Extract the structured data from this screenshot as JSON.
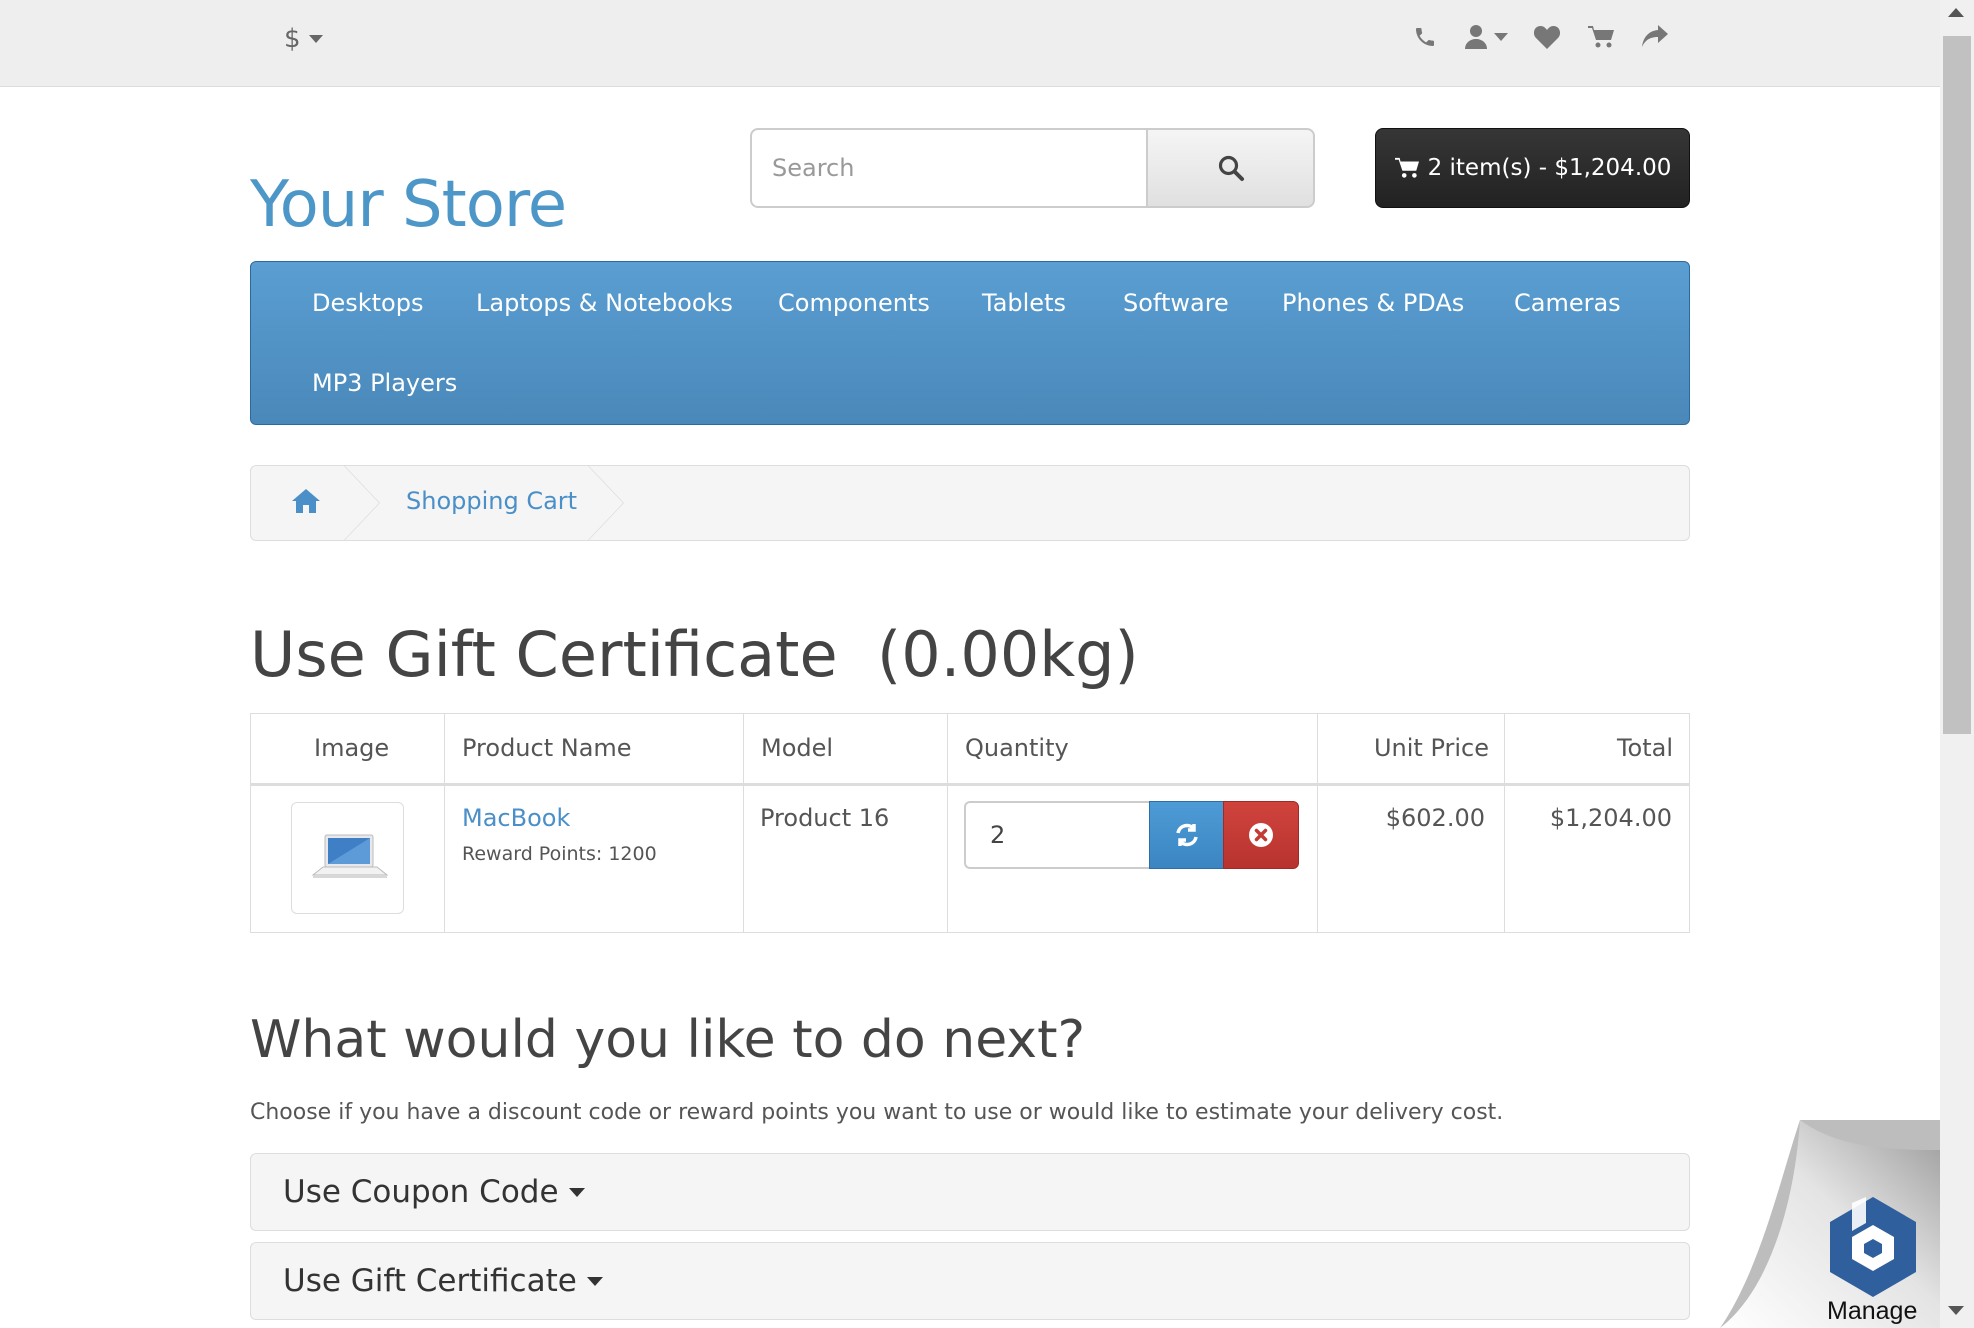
{
  "top_bar": {
    "currency_symbol": "$",
    "icons": [
      "phone-icon",
      "user-icon",
      "heart-icon",
      "cart-icon",
      "share-icon"
    ]
  },
  "header": {
    "logo_text": "Your Store",
    "search_placeholder": "Search",
    "cart_button_label": "2 item(s) - $1,204.00"
  },
  "menu": {
    "items": [
      "Desktops",
      "Laptops & Notebooks",
      "Components",
      "Tablets",
      "Software",
      "Phones & PDAs",
      "Cameras",
      "MP3 Players"
    ]
  },
  "breadcrumb": {
    "home_icon": "home-icon",
    "current": "Shopping Cart"
  },
  "page": {
    "title": "Use Gift Certificate  (0.00kg)"
  },
  "cart_table": {
    "headers": [
      "Image",
      "Product Name",
      "Model",
      "Quantity",
      "Unit Price",
      "Total"
    ],
    "rows": [
      {
        "product_name": "MacBook",
        "reward_points": "Reward Points: 1200",
        "model": "Product 16",
        "quantity": "2",
        "unit_price": "$602.00",
        "total": "$1,204.00"
      }
    ]
  },
  "next_section": {
    "heading": "What would you like to do next?",
    "description": "Choose if you have a discount code or reward points you want to use or would like to estimate your delivery cost.",
    "panels": [
      "Use Coupon Code",
      "Use Gift Certificate"
    ]
  },
  "overlay": {
    "manage_label": "Manage"
  },
  "colors": {
    "brand_blue": "#4d97c8",
    "menu_blue": "#5a9ed2",
    "cart_dark": "#222222",
    "update_blue": "#3b86c2",
    "remove_red": "#c23b36",
    "manage_hex": "#2f5f9c"
  }
}
